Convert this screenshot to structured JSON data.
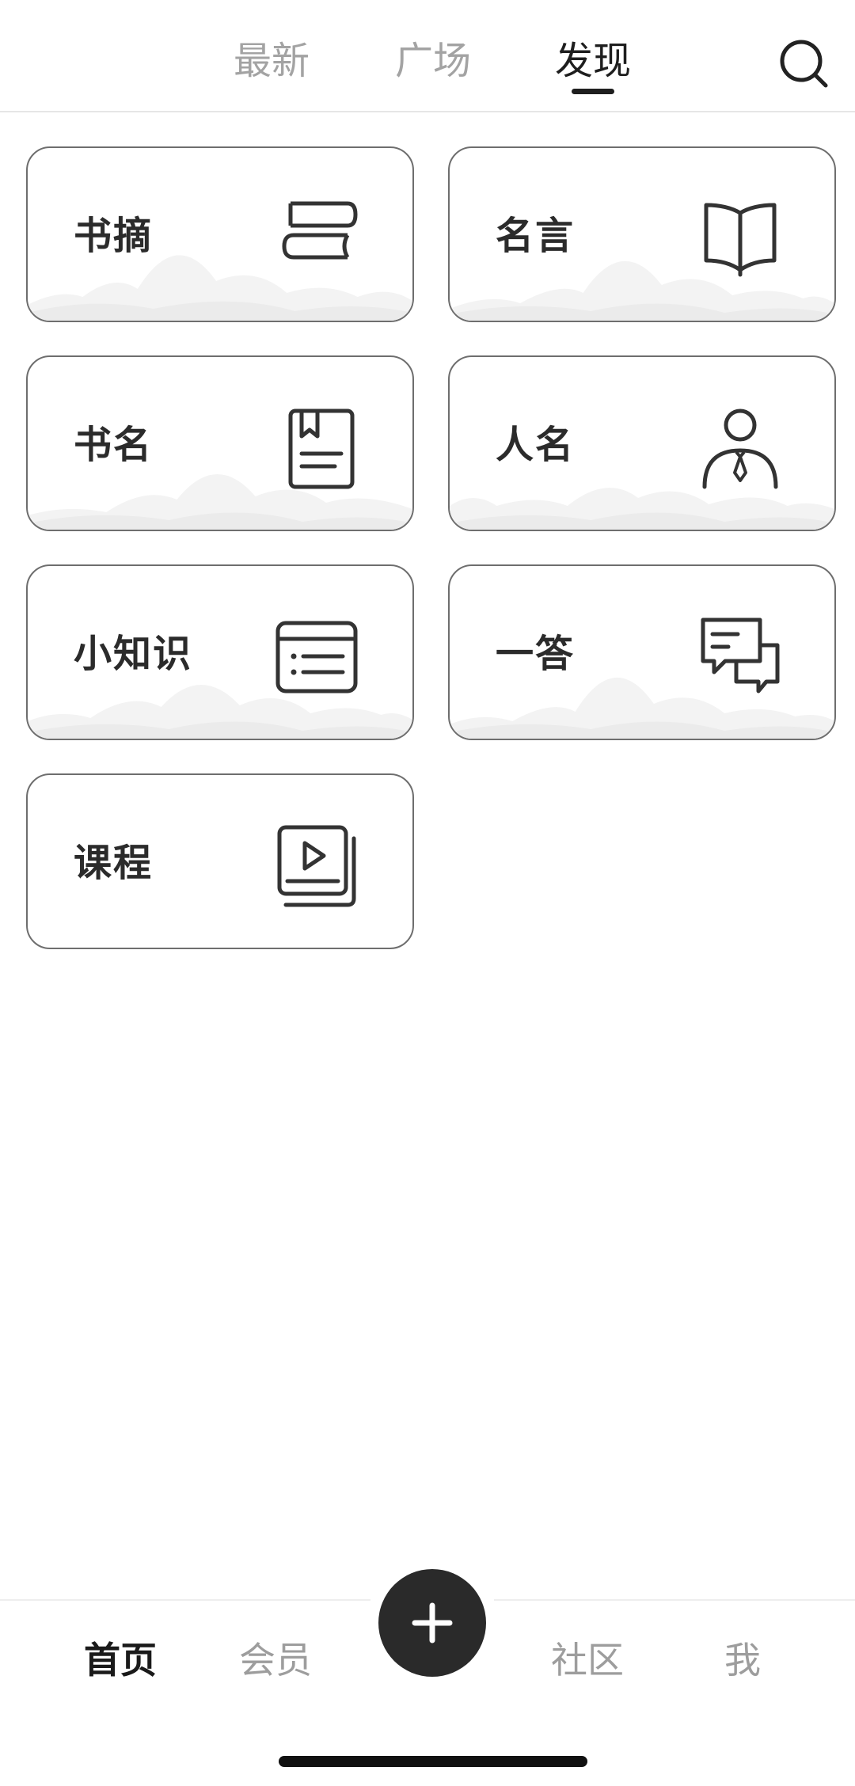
{
  "tabs": [
    {
      "label": "最新",
      "active": false
    },
    {
      "label": "广场",
      "active": false
    },
    {
      "label": "发现",
      "active": true
    }
  ],
  "search_icon": "search-icon",
  "cards": [
    {
      "label": "书摘",
      "icon": "stacked-books-icon"
    },
    {
      "label": "名言",
      "icon": "open-book-icon"
    },
    {
      "label": "书名",
      "icon": "bookmarked-book-icon"
    },
    {
      "label": "人名",
      "icon": "person-tie-icon"
    },
    {
      "label": "小知识",
      "icon": "list-card-icon"
    },
    {
      "label": "一答",
      "icon": "chat-bubbles-icon"
    },
    {
      "label": "课程",
      "icon": "video-course-icon"
    }
  ],
  "bottom_nav": {
    "items": [
      {
        "label": "首页",
        "active": true
      },
      {
        "label": "会员",
        "active": false
      },
      {
        "label": "社区",
        "active": false
      },
      {
        "label": "我",
        "active": false
      }
    ],
    "fab_icon": "plus-icon"
  },
  "colors": {
    "accent": "#2a2a2a",
    "inactive_text": "#a3a3a3",
    "card_border": "#6e6e6e"
  }
}
